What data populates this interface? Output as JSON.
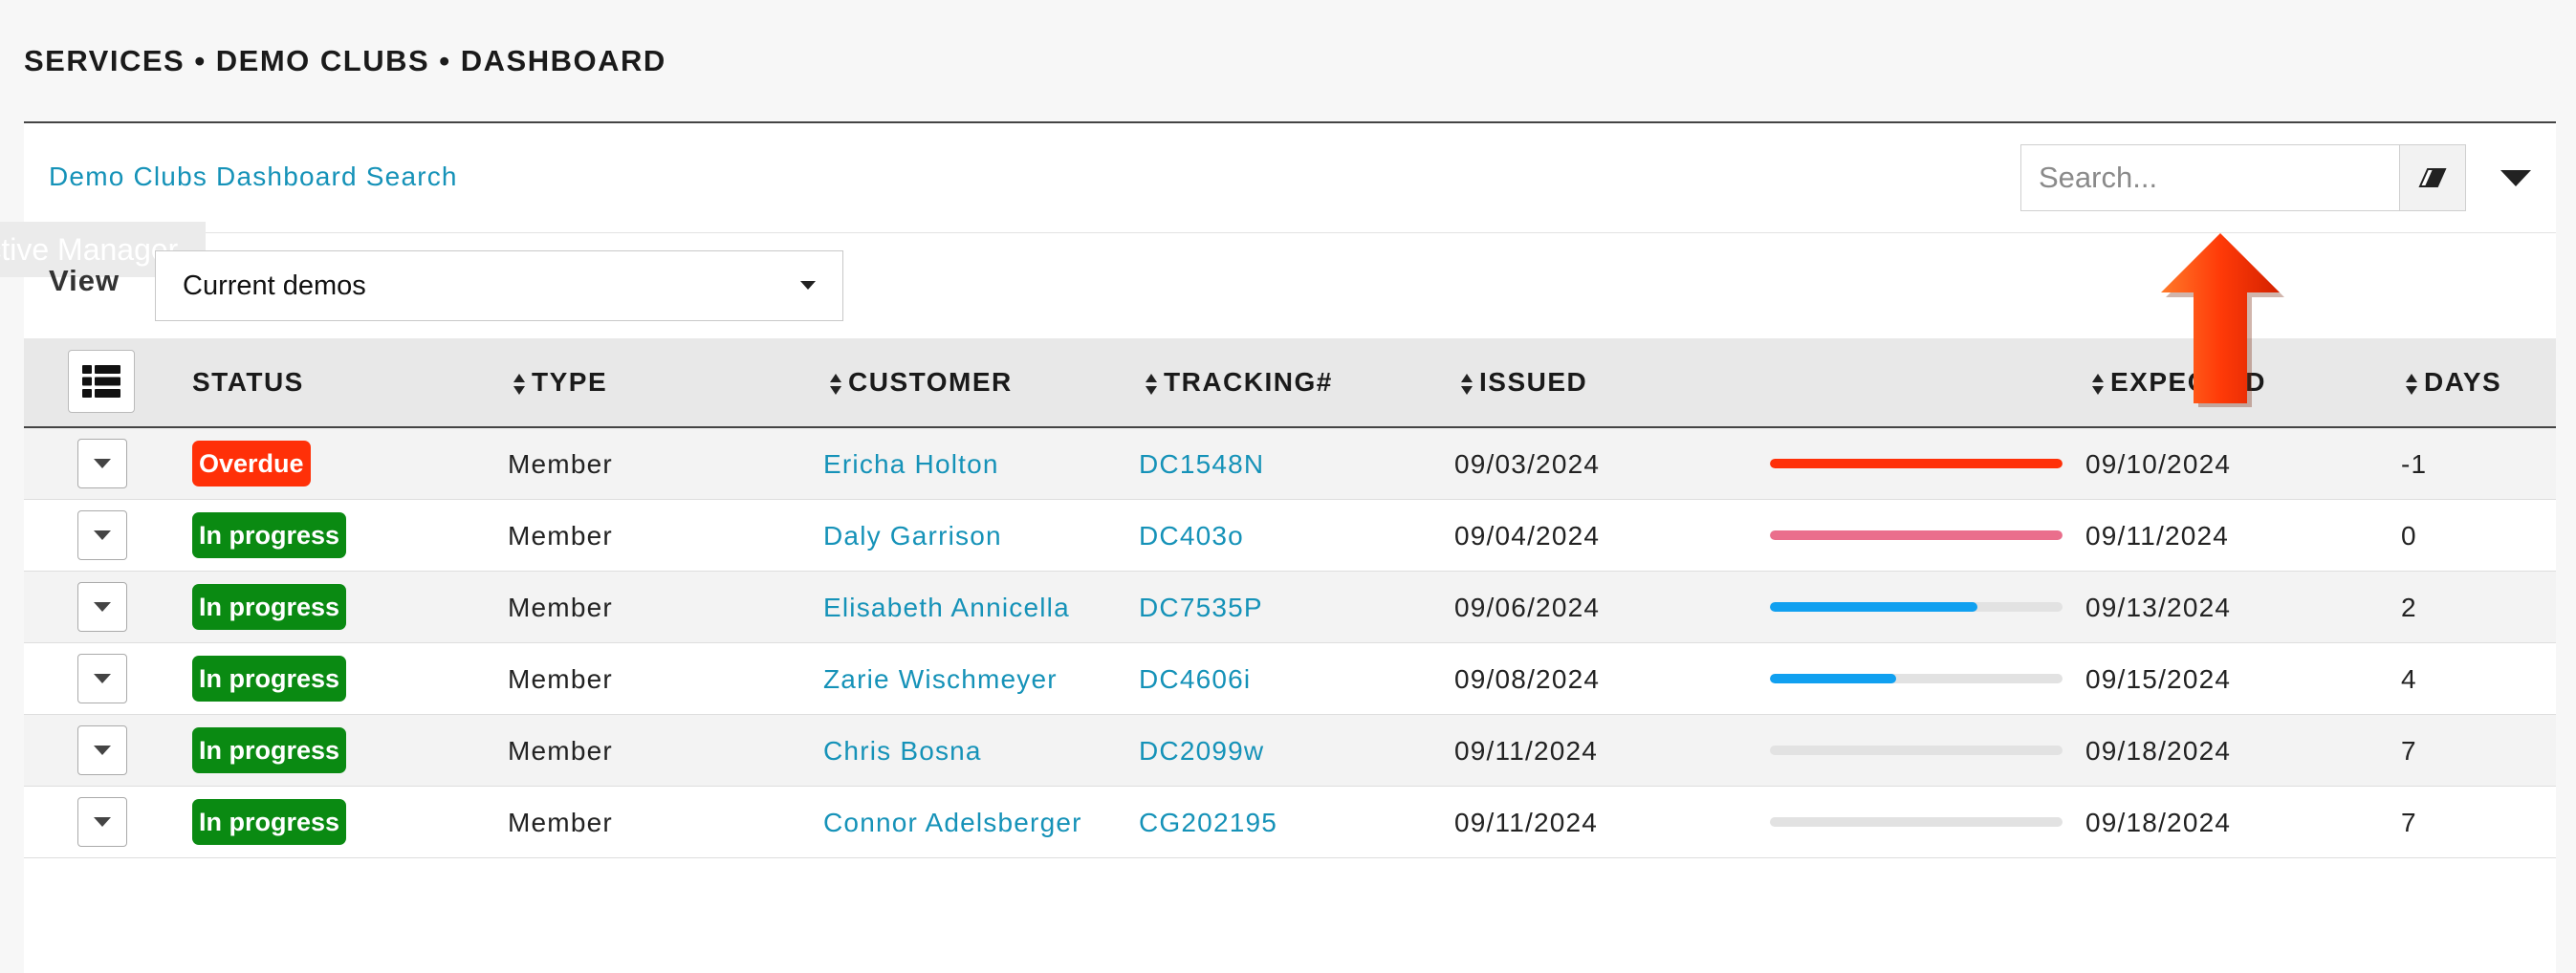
{
  "breadcrumb": "SERVICES • DEMO CLUBS • DASHBOARD",
  "search_panel": {
    "title": "Demo Clubs Dashboard Search",
    "search_placeholder": "Search...",
    "clear_icon": "eraser-icon",
    "collapse_icon": "caret-down-icon"
  },
  "ghost_tooltip": "Active Manager",
  "view": {
    "label": "View",
    "selected": "Current demos"
  },
  "columns": [
    {
      "key": "status",
      "label": "STATUS",
      "sortable": false
    },
    {
      "key": "type",
      "label": "TYPE",
      "sortable": true
    },
    {
      "key": "customer",
      "label": "CUSTOMER",
      "sortable": true
    },
    {
      "key": "tracking",
      "label": "TRACKING#",
      "sortable": true
    },
    {
      "key": "issued",
      "label": "ISSUED",
      "sortable": true
    },
    {
      "key": "expected",
      "label": "EXPECTED",
      "sortable": true
    },
    {
      "key": "days",
      "label": "DAYS",
      "sortable": true
    }
  ],
  "colors": {
    "overdue": "#ff3008",
    "in_progress": "#0a8a12",
    "progress_red": "#ff3008",
    "progress_pink": "#ea6e8c",
    "progress_blue": "#10a0f0",
    "link": "#1592b8"
  },
  "rows": [
    {
      "status": "Overdue",
      "status_color": "#ff3008",
      "type": "Member",
      "customer": "Ericha Holton",
      "tracking": "DC1548N",
      "issued": "09/03/2024",
      "progress": 1.0,
      "progress_color": "#ff3008",
      "expected": "09/10/2024",
      "days": "-1"
    },
    {
      "status": "In progress",
      "status_color": "#0a8a12",
      "type": "Member",
      "customer": "Daly Garrison",
      "tracking": "DC403o",
      "issued": "09/04/2024",
      "progress": 1.0,
      "progress_color": "#ea6e8c",
      "expected": "09/11/2024",
      "days": "0"
    },
    {
      "status": "In progress",
      "status_color": "#0a8a12",
      "type": "Member",
      "customer": "Elisabeth Annicella",
      "tracking": "DC7535P",
      "issued": "09/06/2024",
      "progress": 0.71,
      "progress_color": "#10a0f0",
      "expected": "09/13/2024",
      "days": "2"
    },
    {
      "status": "In progress",
      "status_color": "#0a8a12",
      "type": "Member",
      "customer": "Zarie Wischmeyer",
      "tracking": "DC4606i",
      "issued": "09/08/2024",
      "progress": 0.43,
      "progress_color": "#10a0f0",
      "expected": "09/15/2024",
      "days": "4"
    },
    {
      "status": "In progress",
      "status_color": "#0a8a12",
      "type": "Member",
      "customer": "Chris Bosna",
      "tracking": "DC2099w",
      "issued": "09/11/2024",
      "progress": 0.0,
      "progress_color": "#10a0f0",
      "expected": "09/18/2024",
      "days": "7"
    },
    {
      "status": "In progress",
      "status_color": "#0a8a12",
      "type": "Member",
      "customer": "Connor Adelsberger",
      "tracking": "CG202195",
      "issued": "09/11/2024",
      "progress": 0.0,
      "progress_color": "#10a0f0",
      "expected": "09/18/2024",
      "days": "7"
    }
  ]
}
